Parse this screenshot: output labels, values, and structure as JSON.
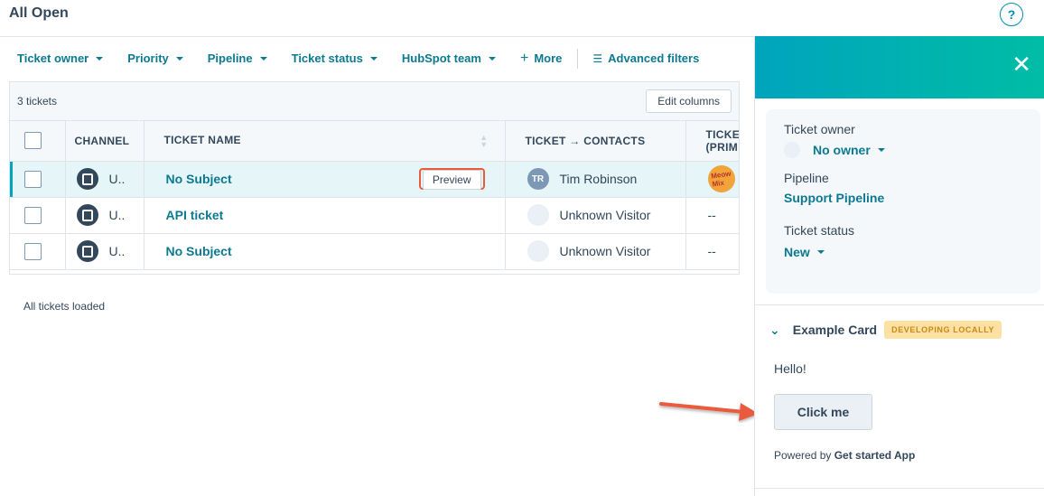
{
  "page": {
    "title": "All Open",
    "help_icon": "question-icon"
  },
  "filters": {
    "items": [
      "Ticket owner",
      "Priority",
      "Pipeline",
      "Ticket status",
      "HubSpot team"
    ],
    "more": "More",
    "advanced": "Advanced filters"
  },
  "table": {
    "count": "3 tickets",
    "edit_columns": "Edit columns",
    "headers": {
      "channel": "CHANNEL",
      "name": "TICKET NAME",
      "contacts": "TICKET → CONTACTS",
      "extra": "TICKE",
      "extra2": "(PRIM"
    },
    "rows": [
      {
        "channel": "U..",
        "name": "No Subject",
        "preview": "Preview",
        "contact": "Tim Robinson",
        "initials": "TR",
        "extra": "MeowMix"
      },
      {
        "channel": "U..",
        "name": "API ticket",
        "contact": "Unknown Visitor",
        "extra": "--"
      },
      {
        "channel": "U..",
        "name": "No Subject",
        "contact": "Unknown Visitor",
        "extra": "--"
      }
    ],
    "loaded": "All tickets loaded"
  },
  "panel": {
    "owner_label": "Ticket owner",
    "owner_value": "No owner",
    "pipeline_label": "Pipeline",
    "pipeline_value": "Support Pipeline",
    "status_label": "Ticket status",
    "status_value": "New",
    "card_title": "Example Card",
    "card_badge": "DEVELOPING LOCALLY",
    "hello": "Hello!",
    "button": "Click me",
    "powered_prefix": "Powered by",
    "powered_app": "Get started App"
  },
  "colors": {
    "accent": "#0b7a91",
    "header_gradient_start": "#00a4bd",
    "header_gradient_end": "#00bda5",
    "highlight": "#ea5a3c",
    "badge_bg": "#fde1a2"
  }
}
